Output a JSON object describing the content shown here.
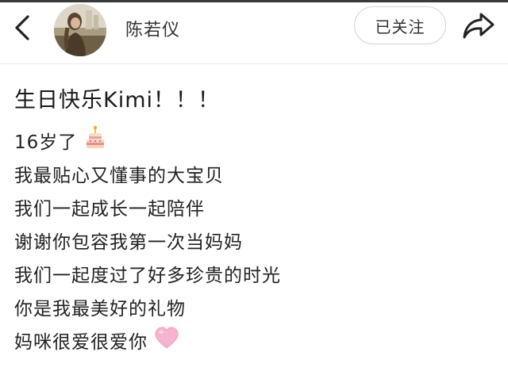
{
  "header": {
    "back_icon": "chevron-left-icon",
    "username": "陈若仪",
    "follow_label": "已关注",
    "share_icon": "share-arrow-icon"
  },
  "post": {
    "title": "生日快乐Kimi！！！",
    "lines": [
      {
        "text": "16岁了",
        "emoji": "birthday-cake-emoji"
      },
      {
        "text": "我最贴心又懂事的大宝贝"
      },
      {
        "text": "我们一起成长一起陪伴"
      },
      {
        "text": "谢谢你包容我第一次当妈妈"
      },
      {
        "text": "我们一起度过了好多珍贵的时光"
      },
      {
        "text": "你是我最美好的礼物"
      },
      {
        "text": "妈咪很爱很爱你",
        "emoji": "pink-heart-emoji"
      }
    ]
  },
  "colors": {
    "text": "#222222",
    "border": "#d2d2d2",
    "heart": "#f7b3cf"
  }
}
